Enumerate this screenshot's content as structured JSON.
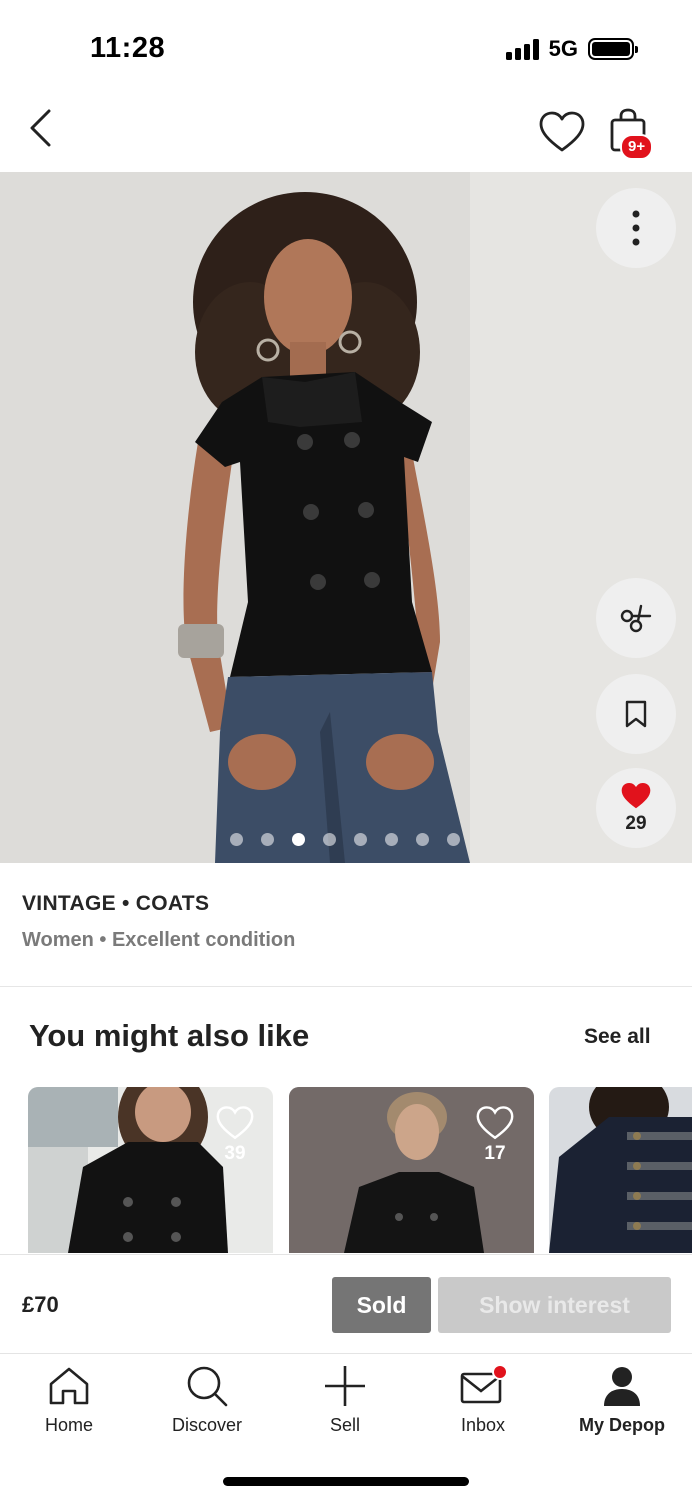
{
  "status_bar": {
    "time": "11:28",
    "network": "5G"
  },
  "top_nav": {
    "bag_badge": "9+"
  },
  "hero": {
    "like_count": "29",
    "image_count": 8,
    "active_image_index": 2
  },
  "item": {
    "category": "VINTAGE • COATS",
    "details": "Women • Excellent condition"
  },
  "recommendations": {
    "title": "You might also like",
    "see_all_label": "See all",
    "items": [
      {
        "likes": "39"
      },
      {
        "likes": "17"
      },
      {
        "likes": ""
      }
    ]
  },
  "purchase": {
    "price": "£70",
    "sold_label": "Sold",
    "interest_label": "Show interest"
  },
  "tabs": [
    {
      "label": "Home",
      "icon": "home-icon"
    },
    {
      "label": "Discover",
      "icon": "search-icon"
    },
    {
      "label": "Sell",
      "icon": "plus-icon"
    },
    {
      "label": "Inbox",
      "icon": "mail-icon"
    },
    {
      "label": "My Depop",
      "icon": "profile-icon",
      "active": true
    }
  ],
  "colors": {
    "accent_red": "#e1121c",
    "sold_gray": "#757575",
    "disabled_gray": "#c9c9c9"
  }
}
